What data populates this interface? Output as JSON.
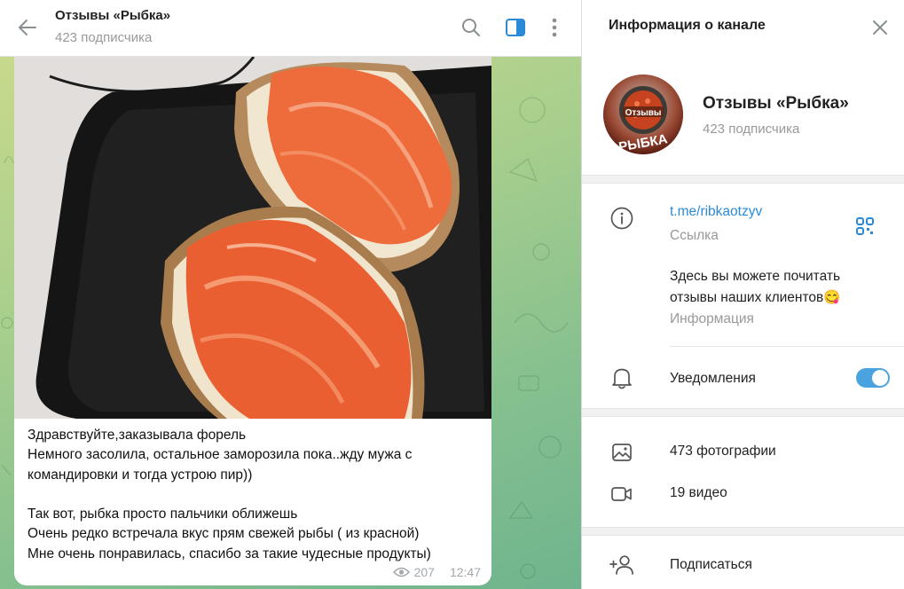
{
  "chat": {
    "title": "Отзывы «Рыбка»",
    "subtitle": "423 подписчика",
    "icons": [
      "back-arrow-icon",
      "search-icon",
      "sidebar-toggle-icon",
      "more-vertical-icon"
    ]
  },
  "message": {
    "lines": [
      "Здравствуйте,заказывала форель",
      "Немного засолила, остальное заморозила пока..жду мужа с",
      "командировки и тогда устрою пир))",
      "",
      "Так вот, рыбка просто пальчики оближешь",
      "Очень редко встречала вкус прям свежей рыбы ( из красной)",
      "Мне очень понравилась, спасибо за такие чудесные продукты)"
    ],
    "views": "207",
    "time": "12:47"
  },
  "panel": {
    "title": "Информация о канале",
    "channel_name": "Отзывы «Рыбка»",
    "subscribers": "423 подписчика",
    "avatar_text_top": "Отзывы",
    "avatar_text_bottom": "РЫБКА",
    "link": "t.me/ribkaotzyv",
    "link_label": "Ссылка",
    "description_lines": [
      "Здесь вы можете почитать",
      "отзывы наших клиентов😋"
    ],
    "description_label": "Информация",
    "notifications_label": "Уведомления",
    "notifications_on": true,
    "photos": "473 фотографии",
    "videos": "19 видео",
    "subscribe": "Подписаться"
  },
  "colors": {
    "accent": "#4aa3df",
    "link": "#2a8ad8",
    "secondary_text": "#999999"
  }
}
